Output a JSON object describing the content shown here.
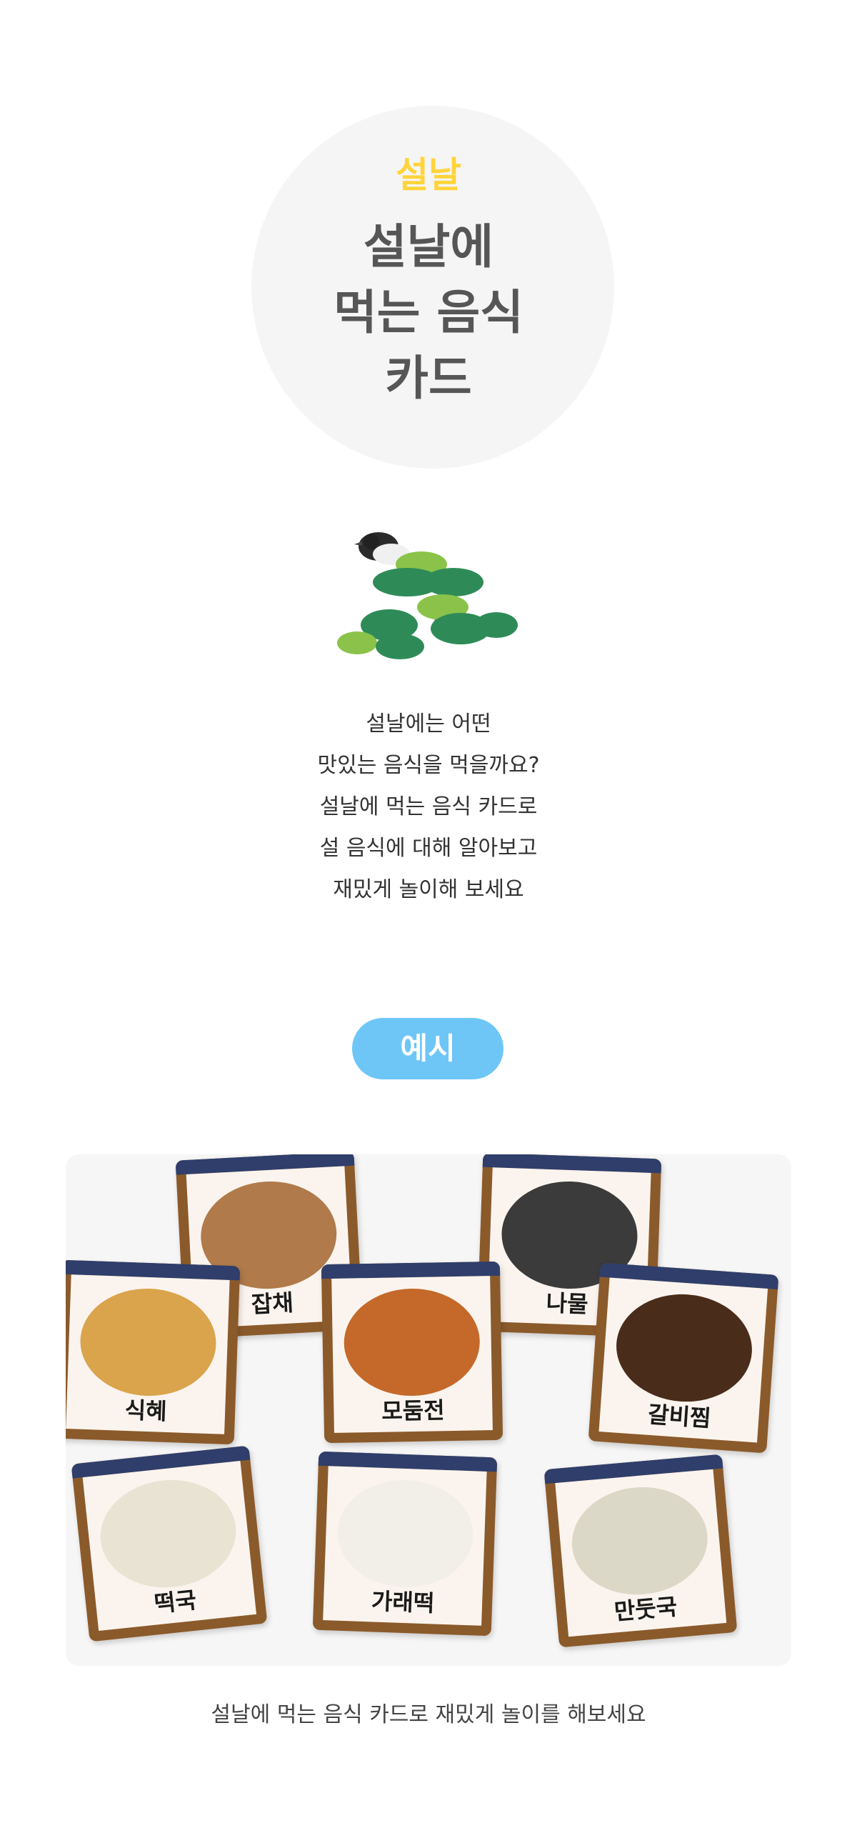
{
  "hero": {
    "eyebrow": "설날",
    "title_lines": [
      "설날에",
      "먹는 음식",
      "카드"
    ]
  },
  "illustration": {
    "icon": "magpie-pine-tree-icon"
  },
  "intro": {
    "lines": [
      "설날에는 어떤",
      "맛있는 음식을 먹을까요?",
      "설날에 먹는 음식 카드로",
      "설 음식에 대해 알아보고",
      "재밌게 놀이해 보세요"
    ]
  },
  "example": {
    "label": "예시"
  },
  "cards": [
    {
      "label": "잡채",
      "food_color": "#b07a4a"
    },
    {
      "label": "나물",
      "food_color": "#3b3b3b"
    },
    {
      "label": "식혜",
      "food_color": "#d9a44c"
    },
    {
      "label": "모둠전",
      "food_color": "#c4692a"
    },
    {
      "label": "갈비찜",
      "food_color": "#4a2c1a"
    },
    {
      "label": "떡국",
      "food_color": "#e9e3d4"
    },
    {
      "label": "가래떡",
      "food_color": "#f2efe8"
    },
    {
      "label": "만둣국",
      "food_color": "#dcd8c8"
    }
  ],
  "caption": "설날에 먹는 음식 카드로 재밌게 놀이를 해보세요",
  "colors": {
    "accent_yellow": "#ffd43b",
    "accent_blue": "#6ec6f7",
    "title_gray": "#565656"
  }
}
